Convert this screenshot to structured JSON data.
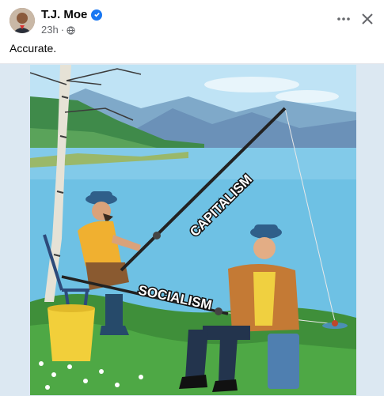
{
  "post": {
    "author": "T.J. Moe",
    "time": "23h",
    "separator": "·",
    "caption": "Accurate.",
    "privacy_icon": "globe-icon",
    "verified_icon": "verified-badge-icon"
  },
  "actions": {
    "more_icon": "more-horizontal-icon",
    "close_icon": "close-icon"
  },
  "meme": {
    "label_top": "CAPITALISM",
    "label_bottom": "SOCIALISM"
  },
  "colors": {
    "accent": "#1877f2",
    "text": "#050505",
    "secondary": "#65676b",
    "frame_bg": "#dce8f2"
  }
}
